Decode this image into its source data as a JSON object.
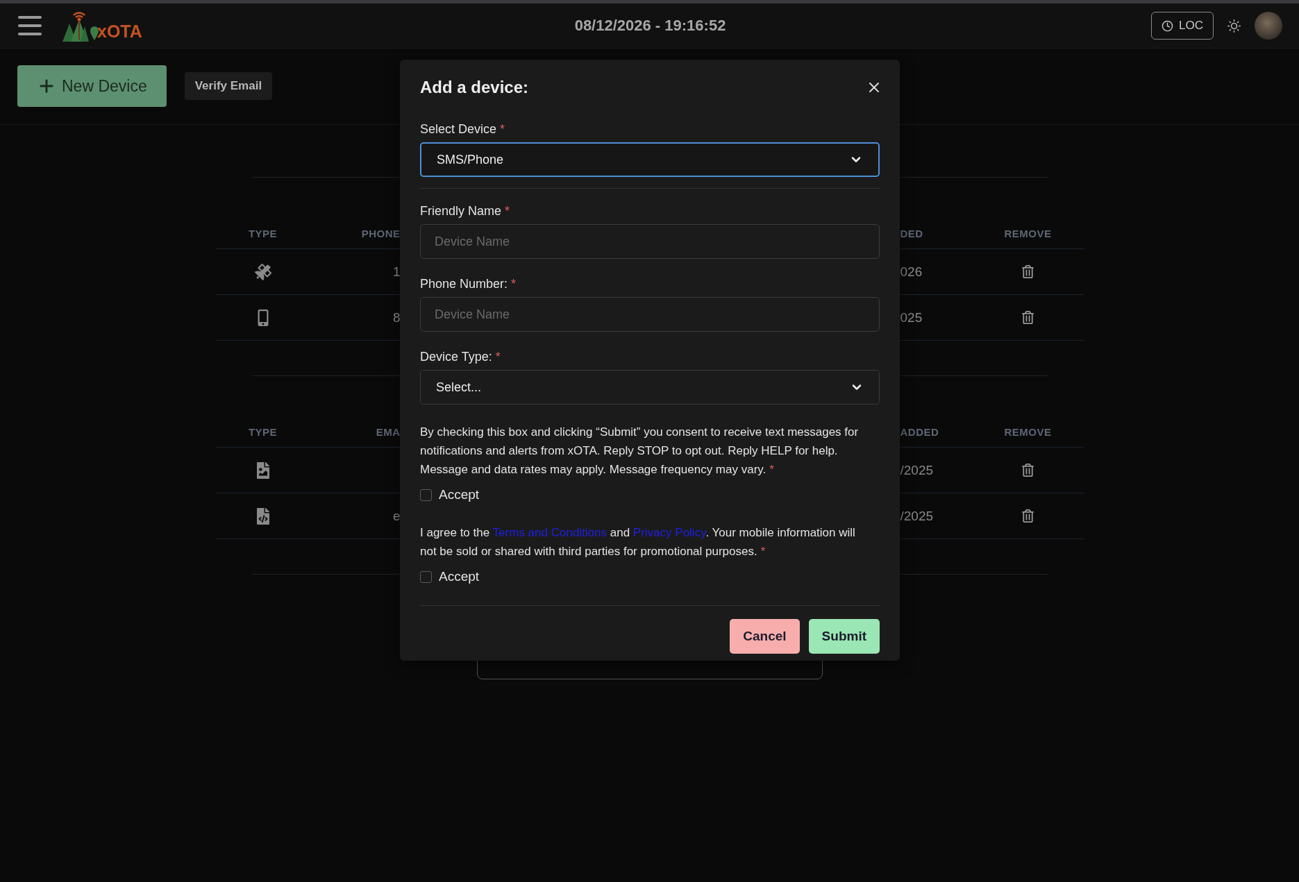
{
  "top_bar": {
    "logo_text": "xOTA",
    "datetime": "08/12/2026 - 19:16:52",
    "timezone_button": "LOC"
  },
  "toolbar": {
    "new_device_button": "New Device",
    "verify_email_button": "Verify Email"
  },
  "tables": [
    {
      "columns": [
        "TYPE",
        "PHONE",
        "DED",
        "REMOVE"
      ],
      "rows": [
        {
          "kind": "satellite",
          "column_2": "1",
          "column_3": "026"
        },
        {
          "kind": "phone",
          "column_2": "8",
          "column_3": "025"
        }
      ]
    },
    {
      "columns": [
        "TYPE",
        "EMA",
        "ADDED",
        "REMOVE"
      ],
      "rows": [
        {
          "kind": "image-file",
          "column_3": "/2025"
        },
        {
          "kind": "code-file",
          "column_2": "e",
          "column_3": "/2025"
        }
      ]
    }
  ],
  "dialog": {
    "title": "Add a device:",
    "fields": [
      {
        "kind": "select",
        "label": "Select Device",
        "required_mark": "*",
        "value": "SMS/Phone",
        "focused": true
      },
      {
        "kind": "input",
        "label": "Friendly Name",
        "required_mark": "*",
        "placeholder": "Device Name",
        "focused": false
      },
      {
        "kind": "input",
        "label": "Phone Number:",
        "required_mark": "*",
        "placeholder": "Device Name",
        "focused": false
      },
      {
        "kind": "select",
        "label": "Device Type:",
        "required_mark": "*",
        "value": "Select...",
        "focused": false
      }
    ],
    "consents": [
      {
        "parts": [
          {
            "kind": "text",
            "text": "By checking this box and clicking “Submit” you consent to receive text messages for notifications and alerts from xOTA. Reply STOP to opt out. Reply HELP for help. Message and data rates may apply. Message frequency may vary."
          }
        ],
        "required_mark": "*",
        "checkbox_label": "Accept",
        "checked": false
      },
      {
        "parts": [
          {
            "kind": "text",
            "text": "I agree to the "
          },
          {
            "kind": "link",
            "text": "Terms and Conditions"
          },
          {
            "kind": "text",
            "text": " and "
          },
          {
            "kind": "link",
            "text": "Privacy Policy"
          },
          {
            "kind": "text",
            "text": ". Your mobile information will not be sold or shared with third parties for promotional purposes."
          }
        ],
        "required_mark": "*",
        "checkbox_label": "Accept",
        "checked": false
      }
    ],
    "buttons": [
      {
        "kind": "cancel",
        "label": "Cancel"
      },
      {
        "kind": "submit",
        "label": "Submit"
      }
    ]
  }
}
